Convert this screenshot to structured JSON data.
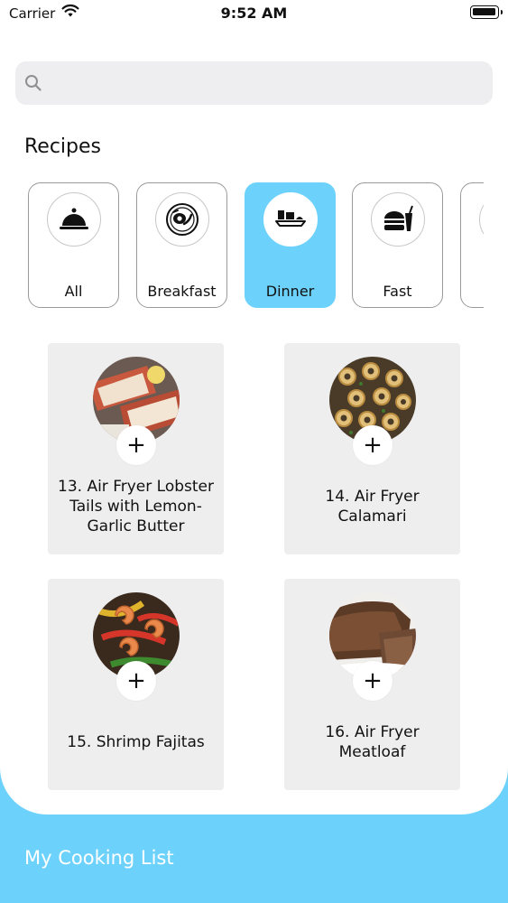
{
  "status_bar": {
    "carrier": "Carrier",
    "time": "9:52 AM"
  },
  "search": {
    "placeholder": "",
    "value": ""
  },
  "section_title": "Recipes",
  "categories": [
    {
      "label": "All",
      "icon": "cloche-icon",
      "selected": false
    },
    {
      "label": "Breakfast",
      "icon": "breakfast-plate-icon",
      "selected": false
    },
    {
      "label": "Dinner",
      "icon": "dinner-tray-icon",
      "selected": true
    },
    {
      "label": "Fast",
      "icon": "fast-food-icon",
      "selected": false
    },
    {
      "label": "",
      "icon": "category-icon",
      "selected": false
    }
  ],
  "recipes": [
    {
      "title": "13. Air Fryer Lobster Tails with Lemon-Garlic Butter",
      "image": "lobster-tails-photo",
      "add_label": "+"
    },
    {
      "title": "14. Air Fryer Calamari",
      "image": "calamari-photo",
      "add_label": "+"
    },
    {
      "title": "15. Shrimp Fajitas",
      "image": "shrimp-fajitas-photo",
      "add_label": "+"
    },
    {
      "title": "16. Air Fryer Meatloaf",
      "image": "meatloaf-photo",
      "add_label": "+"
    }
  ],
  "footer": {
    "title": "My Cooking List"
  },
  "colors": {
    "accent": "#6dd2fb",
    "card": "#efeeef",
    "search_bg": "#eeeef0"
  }
}
